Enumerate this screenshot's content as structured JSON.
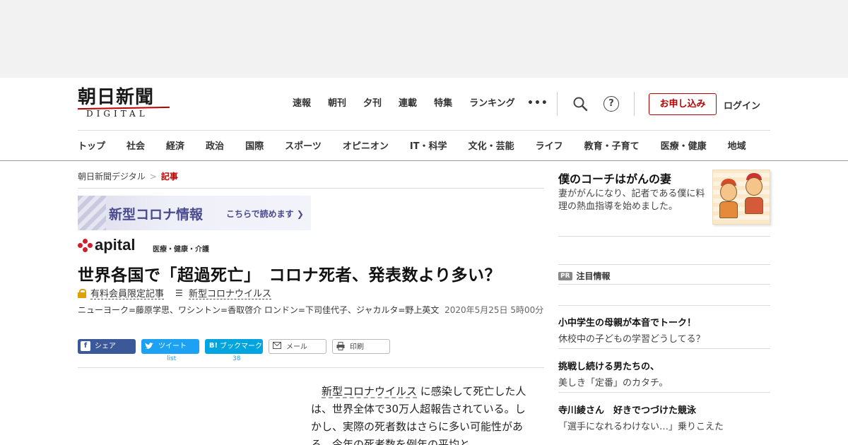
{
  "logo": {
    "kanji": "朝日新聞",
    "latin": "DIGITAL"
  },
  "top_nav": [
    "速報",
    "朝刊",
    "夕刊",
    "連載",
    "特集",
    "ランキング"
  ],
  "more_label": "•••",
  "help_label": "?",
  "subscribe_label": "お申し込み",
  "login_label": "ログイン",
  "section_nav": [
    "トップ",
    "社会",
    "経済",
    "政治",
    "国際",
    "スポーツ",
    "オピニオン",
    "IT・科学",
    "文化・芸能",
    "ライフ",
    "教育・子育て",
    "医療・健康",
    "地域"
  ],
  "breadcrumb": {
    "home": "朝日新聞デジタル",
    "sep": ">",
    "current": "記事"
  },
  "covid_banner": {
    "title": "新型コロナ情報",
    "cta": "こちらで読めます ❯"
  },
  "apital": {
    "word": "apital",
    "category": "医療・健康・介護"
  },
  "article": {
    "headline": "世界各国で「超過死亡」　コロナ死者、発表数より多い？",
    "member_tag": "有料会員限定記事",
    "topic_tag": "新型コロナウイルス",
    "byline": "ニューヨーク=藤原学思、ワシントン=香取啓介 ロンドン=下司佳代子、ジャカルタ=野上英文",
    "date": "2020年5月25日 5時00分",
    "body_link": "新型コロナウイルス",
    "body_rest": "に感染して死亡した人は、世界全体で30万人超報告されている。しかし、実際の死者数はさらに多い可能性がある。今年の死者数を例年の平均と"
  },
  "share": {
    "facebook": "シェア",
    "twitter": "ツイート",
    "twitter_count": "list",
    "hatena": "ブックマーク",
    "hatena_count": "38",
    "mail": "メール",
    "print": "印刷"
  },
  "sidebar": {
    "feature": {
      "title": "僕のコーチはがんの妻",
      "desc": "妻ががんになり、記者である僕に料理の熱血指導を始めました。"
    },
    "pr_badge": "PR",
    "pr_heading": "注目情報",
    "pr_items": [
      {
        "title": "小中学生の母親が本音でトーク！",
        "sub": "休校中の子どもの学習どうしてる？"
      },
      {
        "title": "挑戦し続ける男たちの、",
        "sub": "美しき「定番」のカタチ。"
      },
      {
        "title": "寺川綾さん　好きでつづけた競泳",
        "sub": "「選手になれるわけない…」乗りこえた"
      }
    ]
  }
}
